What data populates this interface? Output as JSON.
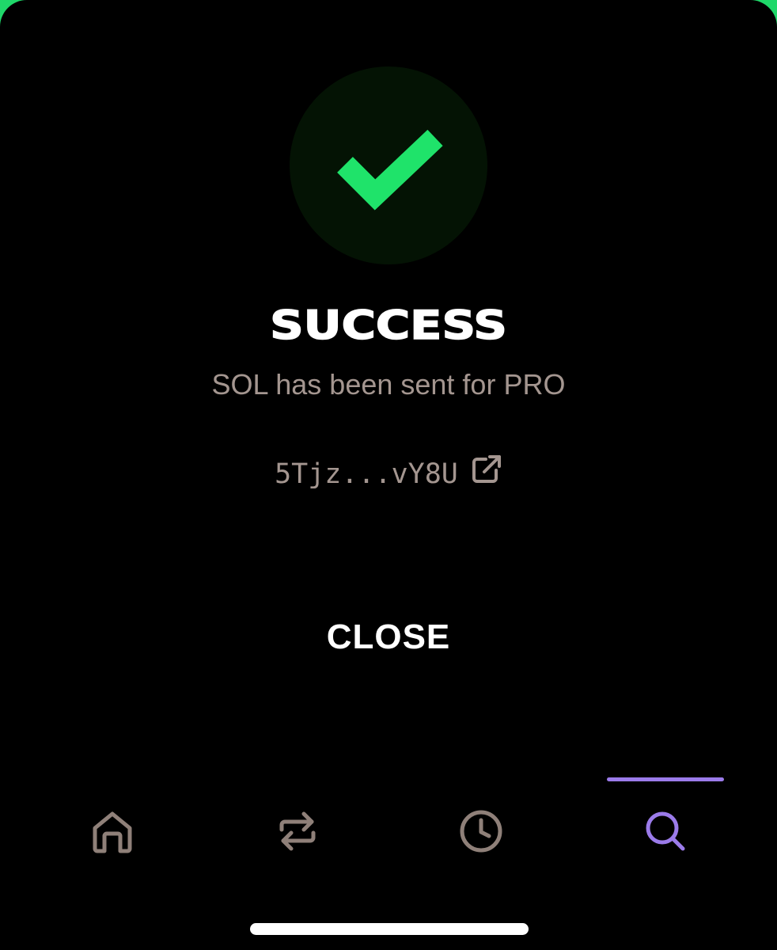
{
  "modal": {
    "status_icon": "checkmark-icon",
    "title": "SUCCESS",
    "message": "SOL has been sent for PRO",
    "transaction": {
      "hash": "5Tjz...vY8U",
      "link_icon": "external-link-icon"
    },
    "close_label": "CLOSE"
  },
  "bottom_nav": {
    "active": "search",
    "items": [
      {
        "id": "home",
        "icon": "home-icon"
      },
      {
        "id": "swap",
        "icon": "swap-arrows-icon"
      },
      {
        "id": "history",
        "icon": "clock-icon"
      },
      {
        "id": "search",
        "icon": "search-icon"
      }
    ]
  },
  "colors": {
    "background": "#000000",
    "success_green": "#1fe36a",
    "success_circle": "#041304",
    "muted_text": "#a49690",
    "nav_inactive": "#8f8079",
    "nav_active": "#9b7bea",
    "frame_edge": "#1fd86a"
  }
}
